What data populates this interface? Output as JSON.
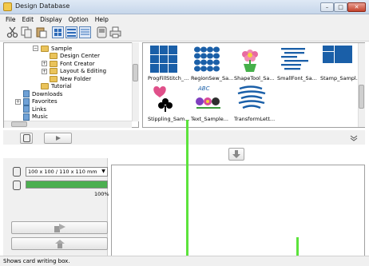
{
  "window": {
    "title": "Design Database",
    "controls": [
      "–",
      "□",
      "✕"
    ]
  },
  "menu": [
    "File",
    "Edit",
    "Display",
    "Option",
    "Help"
  ],
  "toolbar": {
    "icons": [
      "cut-icon",
      "copy-icon",
      "paste-icon",
      "large-icons-view-icon",
      "medium-icons-view-icon",
      "details-view-icon",
      "card-icon",
      "print-icon"
    ]
  },
  "tree": {
    "items": [
      {
        "label": "Sample",
        "indent": 3,
        "expander": "−",
        "kind": "folder"
      },
      {
        "label": "Design Center",
        "indent": 4,
        "expander": "",
        "kind": "folder"
      },
      {
        "label": "Font Creator",
        "indent": 4,
        "expander": "+",
        "kind": "folder"
      },
      {
        "label": "Layout & Editing",
        "indent": 4,
        "expander": "+",
        "kind": "folder"
      },
      {
        "label": "New Folder",
        "indent": 4,
        "expander": "",
        "kind": "folder"
      },
      {
        "label": "Tutorial",
        "indent": 3,
        "expander": "",
        "kind": "folder"
      },
      {
        "label": "Downloads",
        "indent": 1,
        "expander": "",
        "kind": "lib"
      },
      {
        "label": "Favorites",
        "indent": 1,
        "expander": "+",
        "kind": "lib"
      },
      {
        "label": "Links",
        "indent": 1,
        "expander": "",
        "kind": "lib"
      },
      {
        "label": "Music",
        "indent": 1,
        "expander": "",
        "kind": "lib"
      }
    ]
  },
  "thumbnails": [
    {
      "label": "ProgFillStitch_...",
      "icon": "grid-pattern-icon"
    },
    {
      "label": "RegionSew_Sa...",
      "icon": "circle-pattern-icon"
    },
    {
      "label": "ShapeTool_Sa...",
      "icon": "flower-pot-icon"
    },
    {
      "label": "SmallFont_Sa...",
      "icon": "small-text-icon"
    },
    {
      "label": "Stamp_Sampl...",
      "icon": "stamp-icon"
    },
    {
      "label": "Stippling_Sam...",
      "icon": "heart-club-icon"
    },
    {
      "label": "Text_Sample...",
      "icon": "text-flowers-icon"
    },
    {
      "label": "TransformLett...",
      "icon": "transform-letters-icon"
    }
  ],
  "card": {
    "size_option": "100 x 100 / 110 x 110 mm",
    "progress_percent": 100,
    "progress_label": "100%"
  },
  "status": "Shows card writing box.",
  "colors": {
    "thumb_blue": "#1a5fa8",
    "accent_green": "#5ce33c"
  }
}
